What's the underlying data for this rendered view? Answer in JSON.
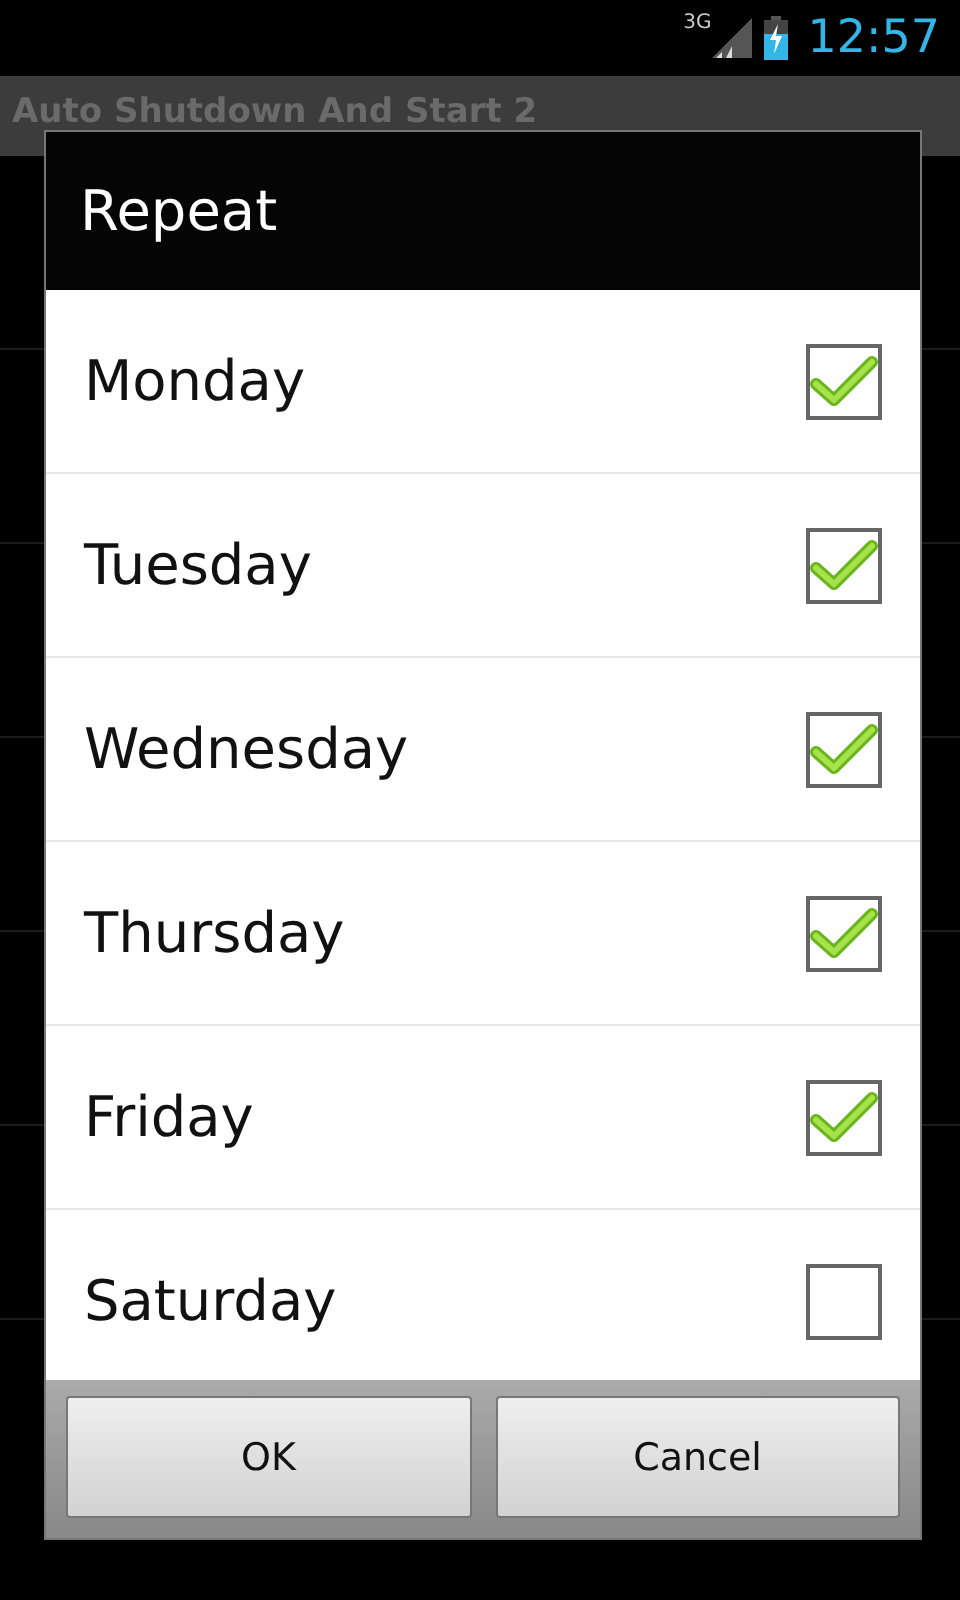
{
  "status_bar": {
    "network": "3G",
    "time": "12:57"
  },
  "app_bar": {
    "title": "Auto Shutdown And Start 2"
  },
  "dialog": {
    "title": "Repeat",
    "items": [
      {
        "label": "Monday",
        "checked": true
      },
      {
        "label": "Tuesday",
        "checked": true
      },
      {
        "label": "Wednesday",
        "checked": true
      },
      {
        "label": "Thursday",
        "checked": true
      },
      {
        "label": "Friday",
        "checked": true
      },
      {
        "label": "Saturday",
        "checked": false
      }
    ],
    "buttons": [
      "OK",
      "Cancel"
    ]
  }
}
